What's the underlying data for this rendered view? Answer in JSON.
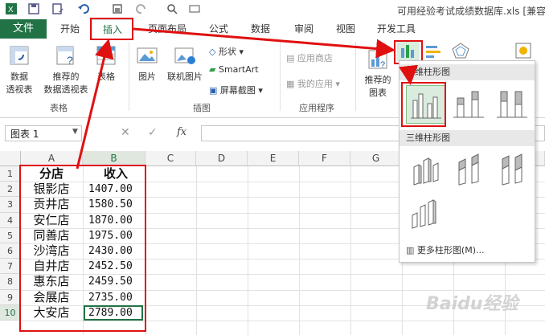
{
  "titlebar": {
    "title": "可用经验考试成绩数据库.xls  [兼容"
  },
  "tabs": {
    "file": "文件",
    "home": "开始",
    "insert": "插入",
    "layout": "页面布局",
    "formulas": "公式",
    "data": "数据",
    "review": "审阅",
    "view": "视图",
    "developer": "开发工具"
  },
  "ribbon": {
    "pivot_line1": "数据",
    "pivot_line2": "透视表",
    "rec_pivot_line1": "推荐的",
    "rec_pivot_line2": "数据透视表",
    "table": "表格",
    "group_tables": "表格",
    "picture": "图片",
    "online_picture": "联机图片",
    "shapes": "形状",
    "smartart": "SmartArt",
    "screenshot": "屏幕截图",
    "group_illustrations": "插图",
    "app_store": "应用商店",
    "my_apps": "我的应用",
    "group_apps": "应用程序",
    "rec_chart_line1": "推荐的",
    "rec_chart_line2": "图表"
  },
  "formula_bar": {
    "name_box": "图表 1",
    "fx": "fx"
  },
  "columns": [
    "A",
    "B",
    "C",
    "D",
    "E",
    "F",
    "G"
  ],
  "rows": [
    "1",
    "2",
    "3",
    "4",
    "5",
    "6",
    "7",
    "8",
    "9",
    "10"
  ],
  "table": {
    "header_a": "分店",
    "header_b": "收入",
    "store_names": [
      "银影店",
      "贡井店",
      "安仁店",
      "同善店",
      "沙湾店",
      "自井店",
      "惠东店",
      "会展店",
      "大安店"
    ],
    "incomes": [
      "1407.00",
      "1580.50",
      "1870.00",
      "1975.00",
      "2430.00",
      "2452.50",
      "2459.50",
      "2735.00",
      "2789.00"
    ]
  },
  "dropdown": {
    "section_2d": "二维柱形图",
    "section_3d": "三维柱形图",
    "more": "更多柱形图(M)..."
  },
  "watermark": "Baidu经验",
  "colors": {
    "accent": "#217346",
    "highlight": "#e01010"
  }
}
